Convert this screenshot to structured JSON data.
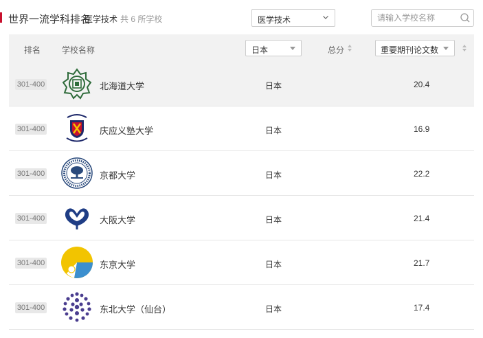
{
  "header": {
    "title": "世界一流学科排名",
    "subject": "医学技术",
    "count_text": "共 6 所学校"
  },
  "filters": {
    "subject_select": "医学技术",
    "search_placeholder": "请输入学校名称"
  },
  "table": {
    "columns": {
      "rank": "排名",
      "name": "学校名称",
      "country_select": "日本",
      "total": "总分",
      "metric_select": "重要期刊论文数"
    },
    "rows": [
      {
        "rank": "301-400",
        "name": "北海道大学",
        "country": "日本",
        "value": "20.4",
        "logo": "hokkaido-logo"
      },
      {
        "rank": "301-400",
        "name": "庆应义塾大学",
        "country": "日本",
        "value": "16.9",
        "logo": "keio-logo"
      },
      {
        "rank": "301-400",
        "name": "京都大学",
        "country": "日本",
        "value": "22.2",
        "logo": "kyoto-logo"
      },
      {
        "rank": "301-400",
        "name": "大阪大学",
        "country": "日本",
        "value": "21.4",
        "logo": "osaka-logo"
      },
      {
        "rank": "301-400",
        "name": "东京大学",
        "country": "日本",
        "value": "21.7",
        "logo": "tokyo-logo"
      },
      {
        "rank": "301-400",
        "name": "东北大学（仙台）",
        "country": "日本",
        "value": "17.4",
        "logo": "tohoku-logo"
      }
    ]
  },
  "colors": {
    "accent": "#c8102e",
    "header_bg": "#f2f2f2",
    "hokkaido_green": "#2e6b3a",
    "keio_navy": "#1f2a6b",
    "keio_red": "#c8102e",
    "keio_yellow": "#f3c300",
    "kyoto_blue": "#2a4a7c",
    "osaka_navy": "#1f3d85",
    "tokyo_yellow": "#f2c400",
    "tokyo_blue": "#3b8fcf",
    "tohoku_purple": "#4a3d8f"
  }
}
